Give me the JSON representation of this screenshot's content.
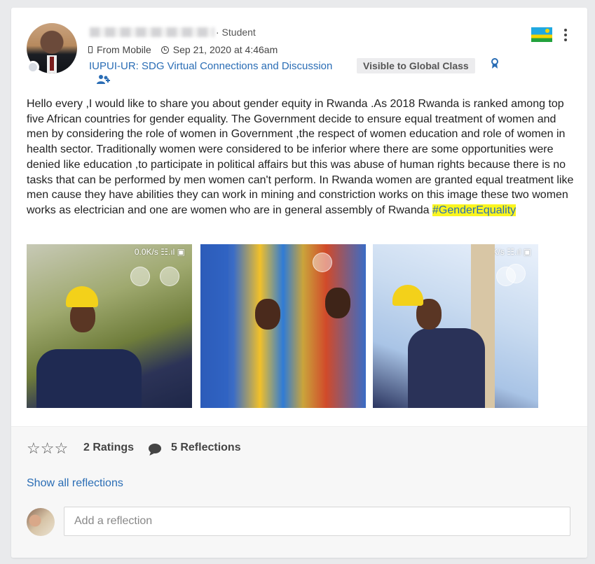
{
  "post": {
    "author_role": "· Student",
    "source": "From Mobile",
    "timestamp": "Sep 21, 2020 at 4:46am",
    "group": "IUPUI-UR: SDG Virtual Connections and Discussion",
    "visibility": "Visible to Global Class",
    "body": "Hello every ,I would like to share you about gender equity in Rwanda .As 2018 Rwanda is ranked among top five African countries for gender equality. The Government decide to ensure equal treatment of women and men by considering the role of women in Government ,the respect of women education and role of women in health sector. Traditionally women were considered to be inferior where there are some opportunities were denied like education ,to participate in political affairs but this was abuse of human rights because there is no tasks that can be performed by men women can't perform. In Rwanda women are granted equal treatment like men cause they have abilities they can work in mining and constriction works on this image these two women works as electrician and one are women who are in general assembly of Rwanda ",
    "hashtag": "#GenderEquality",
    "photos": [
      {
        "status": "0.0K/s ☷.ıl ▣"
      },
      {
        "status": ""
      },
      {
        "status": "0.0K/s ☷.ıl ▣"
      }
    ]
  },
  "footer": {
    "stars": "☆☆☆",
    "ratings": "2 Ratings",
    "reflections": "5 Reflections",
    "show_all": "Show all reflections",
    "reflection_placeholder": "Add a reflection"
  },
  "colors": {
    "link": "#2a6db5",
    "hashtag_highlight": "#fbf51f",
    "background": "#e9eaec"
  },
  "icons": [
    "phone-icon",
    "clock-icon",
    "ribbon-icon",
    "people-icon",
    "rwanda-flag",
    "more-icon",
    "star-icon",
    "bubble-icon"
  ]
}
